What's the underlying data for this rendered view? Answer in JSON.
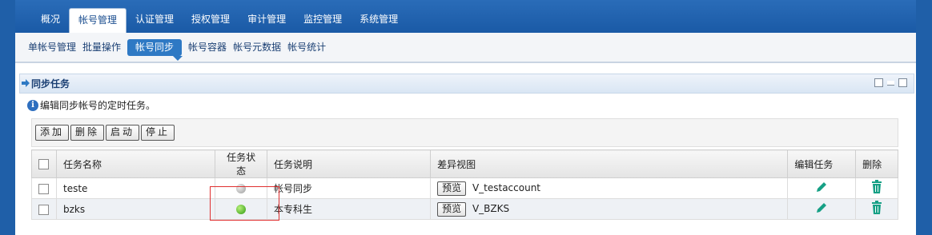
{
  "top_nav": {
    "items": [
      "概况",
      "帐号管理",
      "认证管理",
      "授权管理",
      "审计管理",
      "监控管理",
      "系统管理"
    ],
    "active_index": 1
  },
  "sub_nav": {
    "items": [
      "单帐号管理",
      "批量操作",
      "帐号同步",
      "帐号容器",
      "帐号元数据",
      "帐号统计"
    ],
    "active_index": 2
  },
  "panel": {
    "title": "同步任务",
    "info": "编辑同步帐号的定时任务。"
  },
  "toolbar": {
    "add": "添加",
    "delete": "删除",
    "start": "启动",
    "stop": "停止"
  },
  "table": {
    "headers": [
      "任务名称",
      "任务状态",
      "任务说明",
      "差异视图",
      "编辑任务",
      "删除"
    ],
    "rows": [
      {
        "name": "teste",
        "status": "stopped",
        "desc": "帐号同步",
        "preview": "预览",
        "view": "V_testaccount"
      },
      {
        "name": "bzks",
        "status": "running",
        "desc": "本专科生",
        "preview": "预览",
        "view": "V_BZKS"
      }
    ]
  },
  "colors": {
    "accent": "#1f5fa8",
    "edit_icon": "#16a085",
    "delete_icon": "#16a085",
    "status_running": "#2f9a10",
    "status_stopped": "#9a9a9a",
    "highlight": "#e03030"
  }
}
